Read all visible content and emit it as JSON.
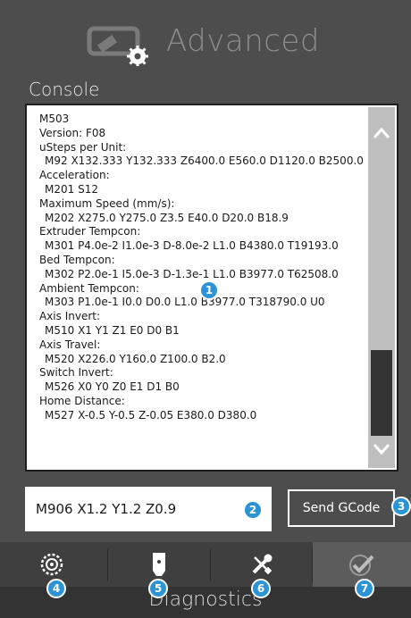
{
  "header": {
    "title": "Advanced",
    "icon": "printer-settings-icon"
  },
  "console": {
    "label": "Console",
    "lines": [
      {
        "text": "M503",
        "indent": false
      },
      {
        "text": "Version: F08",
        "indent": false
      },
      {
        "text": "uSteps per Unit:",
        "indent": false
      },
      {
        "text": "M92 X132.333 Y132.333 Z6400.0 E560.0 D1120.0 B2500.0",
        "indent": true
      },
      {
        "text": "Acceleration:",
        "indent": false
      },
      {
        "text": "M201 S12",
        "indent": true
      },
      {
        "text": "Maximum Speed (mm/s):",
        "indent": false
      },
      {
        "text": "M202 X275.0 Y275.0 Z3.5 E40.0 D20.0 B18.9",
        "indent": true
      },
      {
        "text": "Extruder Tempcon:",
        "indent": false
      },
      {
        "text": "M301 P4.0e-2 I1.0e-3 D-8.0e-2 L1.0 B4380.0 T19193.0",
        "indent": true
      },
      {
        "text": "Bed Tempcon:",
        "indent": false
      },
      {
        "text": "M302 P2.0e-1 I5.0e-3 D-1.3e-1 L1.0 B3977.0 T62508.0",
        "indent": true
      },
      {
        "text": "Ambient Tempcon:",
        "indent": false
      },
      {
        "text": "M303 P1.0e-1 I0.0 D0.0 L1.0 B3977.0 T318790.0 U0",
        "indent": true
      },
      {
        "text": "Axis Invert:",
        "indent": false
      },
      {
        "text": "M510 X1 Y1 Z1 E0 D0 B1",
        "indent": true
      },
      {
        "text": "Axis Travel:",
        "indent": false
      },
      {
        "text": "M520 X226.0 Y160.0 Z100.0 B2.0",
        "indent": true
      },
      {
        "text": "Switch Invert:",
        "indent": false
      },
      {
        "text": "M526 X0 Y0 Z0 E1 D1 B0",
        "indent": true
      },
      {
        "text": "Home Distance:",
        "indent": false
      },
      {
        "text": "M527 X-0.5 Y-0.5 Z-0.05 E380.0 D380.0",
        "indent": true
      }
    ],
    "scroll_position": 0.82
  },
  "gcode": {
    "value": "M906 X1.2 Y1.2 Z0.9",
    "send_label": "Send GCode"
  },
  "badges": [
    "1",
    "2",
    "3",
    "4",
    "5",
    "6",
    "7"
  ],
  "tabs": [
    {
      "icon": "reel-icon",
      "active": false
    },
    {
      "icon": "nozzle-head-icon",
      "active": false
    },
    {
      "icon": "wrench-screwdriver-icon",
      "active": false
    },
    {
      "icon": "checkmark-icon",
      "active": true
    }
  ],
  "footer": {
    "label": "Diagnostics"
  },
  "colors": {
    "accent": "#2c94d6",
    "background": "#4d4d4d",
    "console_bg": "#ffffff"
  }
}
